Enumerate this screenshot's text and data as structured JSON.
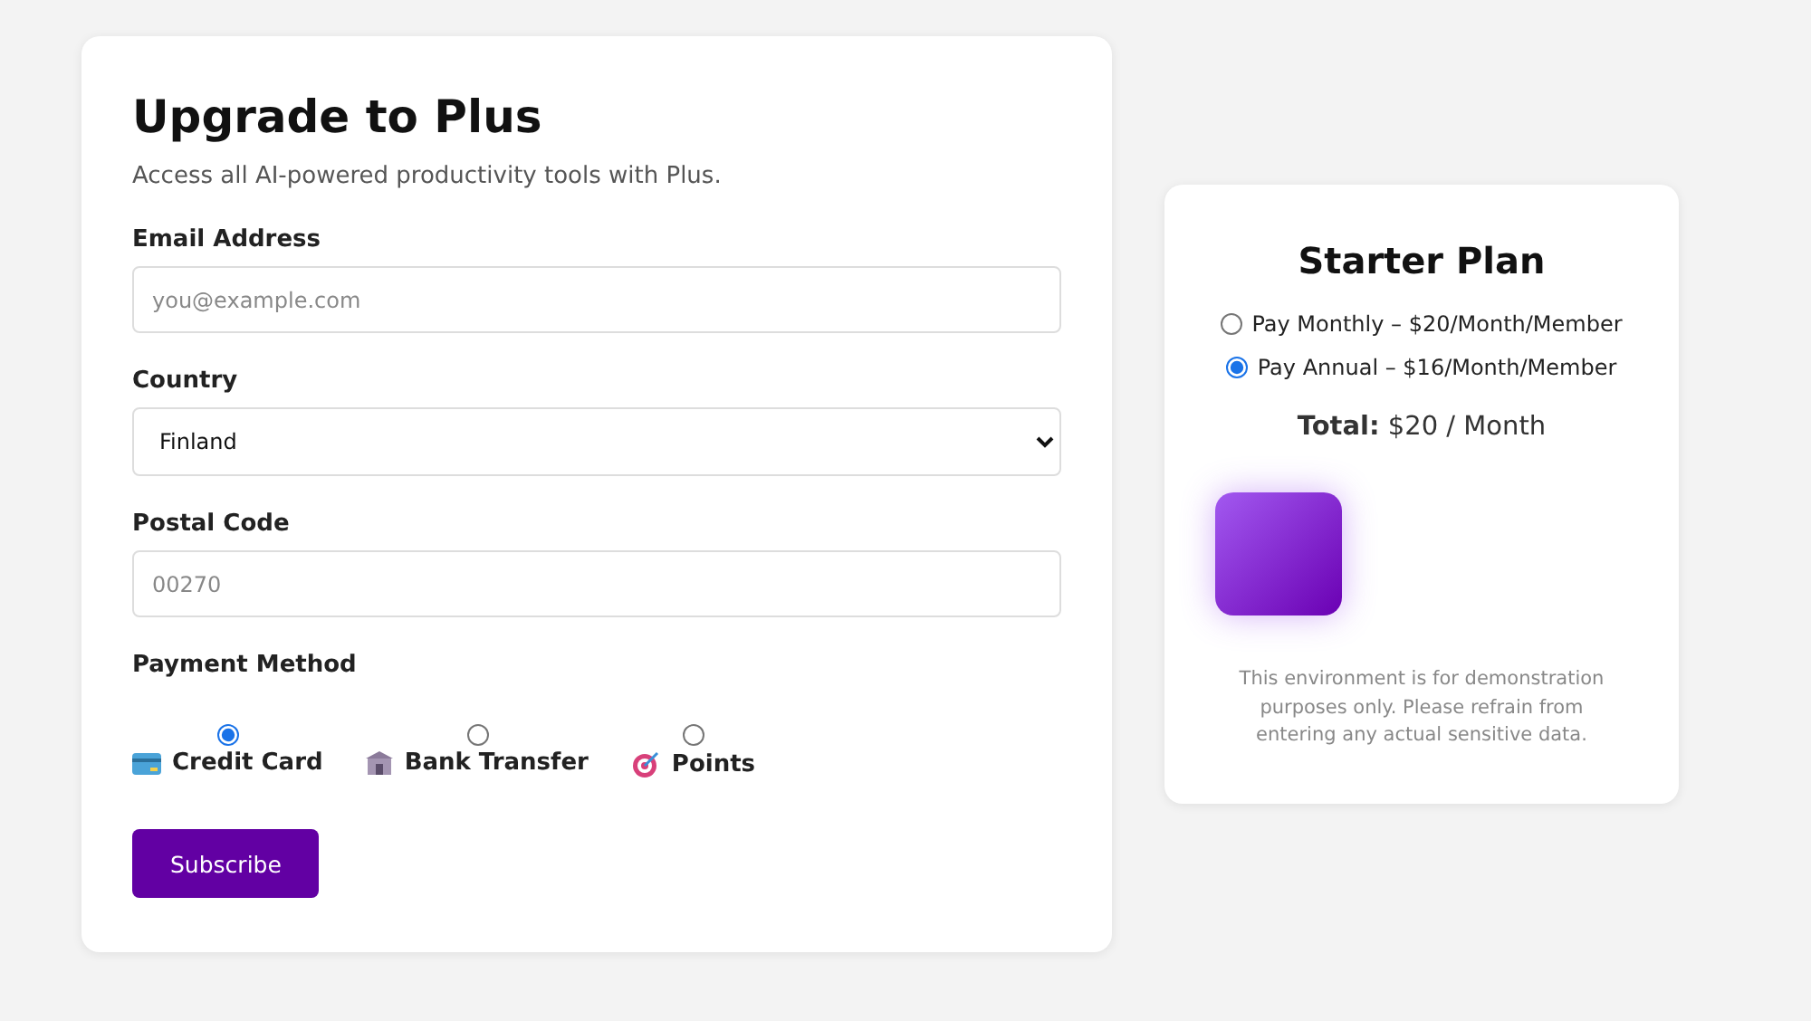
{
  "form": {
    "title": "Upgrade to Plus",
    "subtitle": "Access all AI-powered productivity tools with Plus.",
    "fields": [
      {
        "kind": "input",
        "label": "Email Address",
        "placeholder": "you@example.com"
      },
      {
        "kind": "select",
        "label": "Country",
        "value": "Finland"
      },
      {
        "kind": "input",
        "label": "Postal Code",
        "placeholder": "00270"
      }
    ],
    "payment": {
      "label": "Payment Method",
      "options": [
        {
          "kind": "card",
          "label": "Credit Card",
          "selected": true
        },
        {
          "kind": "bank",
          "label": "Bank Transfer",
          "selected": false
        },
        {
          "kind": "target",
          "label": "Points",
          "selected": false
        }
      ]
    },
    "button": "Subscribe"
  },
  "plan": {
    "title": "Starter Plan",
    "options": [
      {
        "label": "Pay Monthly – $20/Month/Member",
        "selected": false
      },
      {
        "label": "Pay Annual – $16/Month/Member",
        "selected": true
      }
    ],
    "total": "**Total:** $20 / Month",
    "notice": "This environment is for demonstration purposes only. Please refrain from entering any actual sensitive data."
  }
}
